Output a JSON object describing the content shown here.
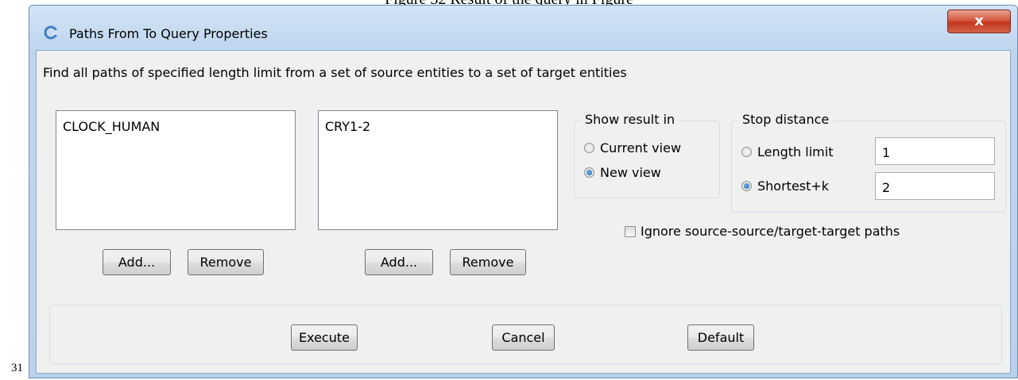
{
  "document": {
    "caption": "Figure 32 Result of the query in Figure",
    "page_number": "31"
  },
  "window": {
    "title": "Paths From To Query Properties",
    "close_label": "x"
  },
  "description": "Find all paths of specified length limit from a set of source entities to a set of target entities",
  "source_list": {
    "items": [
      "CLOCK_HUMAN"
    ],
    "add_label": "Add...",
    "remove_label": "Remove"
  },
  "target_list": {
    "items": [
      "CRY1-2"
    ],
    "add_label": "Add...",
    "remove_label": "Remove"
  },
  "show_result": {
    "title": "Show result in",
    "options": [
      {
        "label": "Current view",
        "checked": false
      },
      {
        "label": "New view",
        "checked": true
      }
    ]
  },
  "stop_distance": {
    "title": "Stop distance",
    "options": [
      {
        "label": "Length limit",
        "value": "1",
        "checked": false
      },
      {
        "label": "Shortest+k",
        "value": "2",
        "checked": true
      }
    ]
  },
  "ignore_paths": {
    "label": "Ignore source-source/target-target paths",
    "checked": false
  },
  "actions": {
    "execute": "Execute",
    "cancel": "Cancel",
    "default": "Default"
  }
}
